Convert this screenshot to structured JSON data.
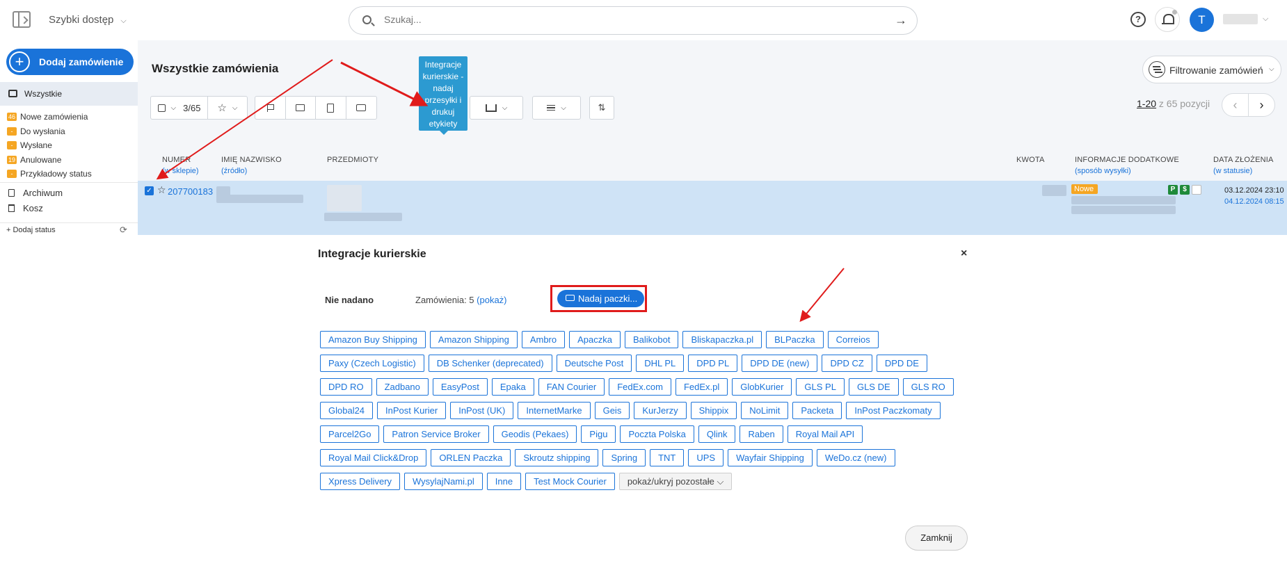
{
  "topbar": {
    "quick_access": "Szybki dostęp",
    "search_placeholder": "Szukaj..."
  },
  "user": {
    "initial": "T"
  },
  "sidebar": {
    "add_order": "Dodaj zamówienie",
    "all": "Wszystkie",
    "statuses": [
      {
        "badge": "46",
        "label": "Nowe zamówienia"
      },
      {
        "badge": "-",
        "label": "Do wysłania"
      },
      {
        "badge": "-",
        "label": "Wysłane"
      },
      {
        "badge": "19",
        "label": "Anulowane"
      },
      {
        "badge": "-",
        "label": "Przykładowy status"
      }
    ],
    "archive": "Archiwum",
    "trash": "Kosz",
    "add_status": "+ Dodaj status"
  },
  "header": {
    "title": "Wszystkie zamówienia",
    "filter": "Filtrowanie zamówień",
    "selection": "3/65",
    "tooltip": "Integracje kurierskie - nadaj przesyłki i drukuj etykiety"
  },
  "pagination": {
    "range": "1-20",
    "rest": " z 65 pozycji"
  },
  "columns": {
    "number": "NUMER",
    "number_sub": "(w sklepie)",
    "name": "IMIĘ NAZWISKO",
    "name_sub": "(źródło)",
    "items": "PRZEDMIOTY",
    "amount": "KWOTA",
    "info": "INFORMACJE DODATKOWE",
    "info_sub": "(sposób wysyłki)",
    "date": "DATA ZŁOŻENIA",
    "date_sub": "(w statusie)"
  },
  "order": {
    "number": "207700183",
    "status": "Nowe",
    "date_created": "03.12.2024 23:10",
    "date_status": "04.12.2024 08:15",
    "badge_p": "P",
    "badge_d": "$"
  },
  "modal": {
    "title": "Integracje kurierskie",
    "not_sent": "Nie nadano",
    "orders_label": "Zamówienia: 5 ",
    "orders_link": "(pokaż)",
    "send_button": "Nadaj paczki...",
    "couriers": [
      "Amazon Buy Shipping",
      "Amazon Shipping",
      "Ambro",
      "Apaczka",
      "Balikobot",
      "Bliskapaczka.pl",
      "BLPaczka",
      "Correios",
      "Paxy (Czech Logistic)",
      "DB Schenker (deprecated)",
      "Deutsche Post",
      "DHL PL",
      "DPD PL",
      "DPD DE (new)",
      "DPD CZ",
      "DPD DE",
      "DPD RO",
      "Zadbano",
      "EasyPost",
      "Epaka",
      "FAN Courier",
      "FedEx.com",
      "FedEx.pl",
      "GlobKurier",
      "GLS PL",
      "GLS DE",
      "GLS RO",
      "Global24",
      "InPost Kurier",
      "InPost (UK)",
      "InternetMarke",
      "Geis",
      "KurJerzy",
      "Shippix",
      "NoLimit",
      "Packeta",
      "InPost Paczkomaty",
      "Parcel2Go",
      "Patron Service Broker",
      "Geodis (Pekaes)",
      "Pigu",
      "Poczta Polska",
      "Qlink",
      "Raben",
      "Royal Mail API",
      "Royal Mail Click&Drop",
      "ORLEN Paczka",
      "Skroutz shipping",
      "Spring",
      "TNT",
      "UPS",
      "Wayfair Shipping",
      "WeDo.cz (new)",
      "Xpress Delivery",
      "WysylajNami.pl",
      "Inne",
      "Test Mock Courier"
    ],
    "toggle_more": "pokaż/ukryj pozostałe ⌵",
    "close": "Zamknij"
  },
  "colors": {
    "accent": "#1a73d9",
    "highlight": "#e01b1b",
    "badge": "#f5a623",
    "row": "#cfe3f6"
  }
}
